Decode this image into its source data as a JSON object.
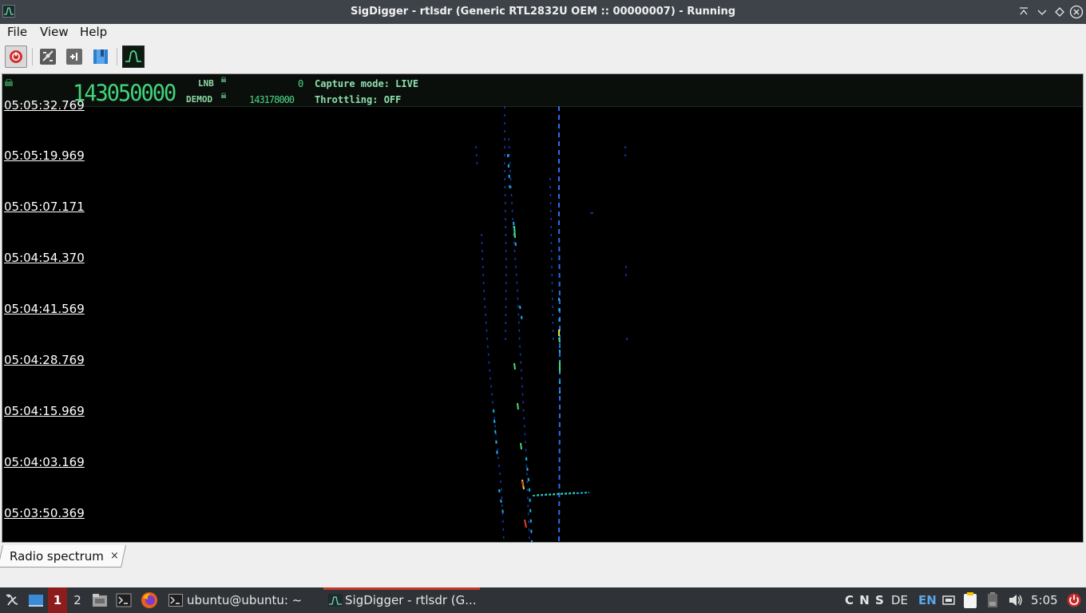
{
  "window": {
    "title": "SigDigger - rtlsdr (Generic RTL2832U OEM :: 00000007) - Running"
  },
  "menu": {
    "file": "File",
    "view": "View",
    "help": "Help"
  },
  "toolbar": {
    "buttons": [
      "power-button",
      "settings-button",
      "add-panel-button",
      "bookmarks-button",
      "spectrum-button"
    ]
  },
  "infobar": {
    "frequency": "143050000",
    "lnb_label": "LNB",
    "lnb_value": "0",
    "demod_label": "DEMOD",
    "demod_value": "143178000",
    "capture_mode": "Capture mode: LIVE",
    "throttling": "Throttling: OFF"
  },
  "waterfall": {
    "top_partial_label": "05:05:32.769",
    "time_labels": [
      "05:05:19.969",
      "05:05:07.171",
      "05:04:54.370",
      "05:04:41.569",
      "05:04:28.769",
      "05:04:15.969",
      "05:04:03.169",
      "05:03:50.369"
    ]
  },
  "tabs": {
    "radio_spectrum": "Radio spectrum",
    "close": "×"
  },
  "taskbar": {
    "workspace_1": "1",
    "workspace_2": "2",
    "terminal_task": "ubuntu@ubuntu: ~",
    "sigdigger_task": "SigDigger - rtlsdr (G...",
    "kbd_indicators": "C N S",
    "layout_de": "DE",
    "layout_en": "EN",
    "clock": "5:05"
  },
  "colors": {
    "titlebar": "#3d4349",
    "waterfall_bg": "#000000",
    "freq_green": "#42d47a",
    "taskbar": "#2f3337",
    "active_workspace": "#8b1d1d",
    "active_task_line": "#c0392b"
  }
}
